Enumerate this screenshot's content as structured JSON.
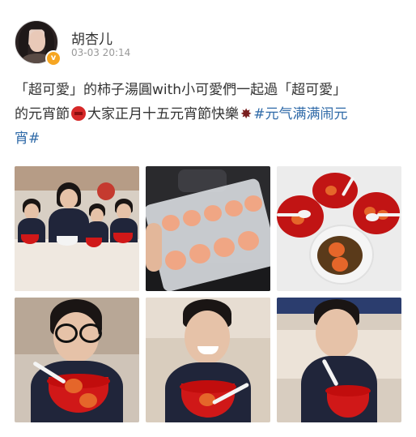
{
  "user": {
    "name": "胡杏儿",
    "timestamp": "03-03 20:14",
    "verified_badge": "v"
  },
  "post": {
    "line1": "「超可愛」的柿子湯圓with小可愛們一起過「超可愛」",
    "line2_part1": "的元宵節",
    "line2_part2": "大家正月十五元宵節快樂",
    "hashtag_part1": "#元气满满闹元",
    "hashtag_part2": "宵#"
  },
  "photos": [
    {
      "id": 1,
      "subject": "family-with-bowls"
    },
    {
      "id": 2,
      "subject": "persimmon-tangyuan-tray"
    },
    {
      "id": 3,
      "subject": "bowls-of-tangyuan"
    },
    {
      "id": 4,
      "subject": "boy-with-glasses-bowl"
    },
    {
      "id": 5,
      "subject": "boy-smiling-bowl"
    },
    {
      "id": 6,
      "subject": "boy-holding-bowl"
    }
  ],
  "watermark": "",
  "colors": {
    "hashtag": "#2f6aa8",
    "bowl_red": "#d01818",
    "tangyuan_orange": "#e5662a",
    "text": "#333333"
  }
}
